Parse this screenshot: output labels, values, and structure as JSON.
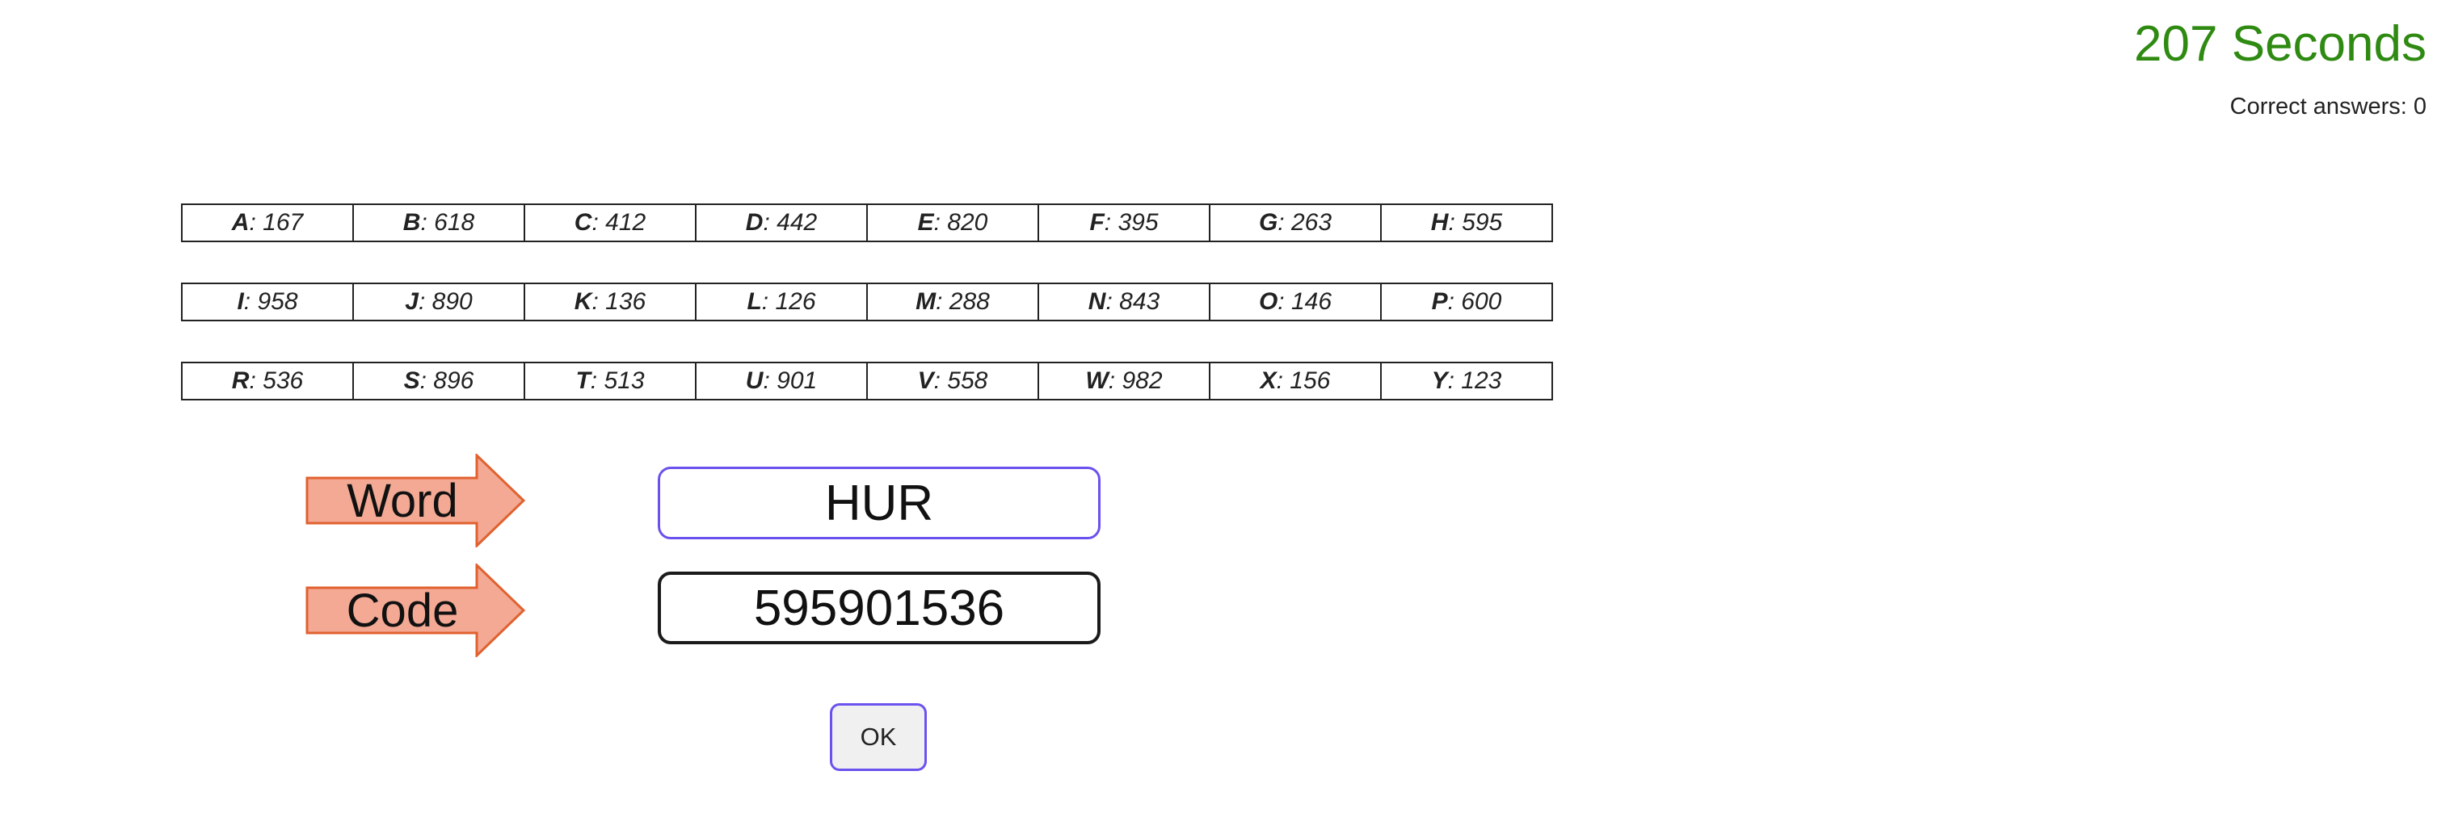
{
  "timer": "207 Seconds",
  "correct_answers": "Correct answers: 0",
  "code_table": [
    [
      {
        "letter": "A",
        "value": ": 167"
      },
      {
        "letter": "B",
        "value": ": 618"
      },
      {
        "letter": "C",
        "value": ": 412"
      },
      {
        "letter": "D",
        "value": ": 442"
      },
      {
        "letter": "E",
        "value": ": 820"
      },
      {
        "letter": "F",
        "value": ": 395"
      },
      {
        "letter": "G",
        "value": ": 263"
      },
      {
        "letter": "H",
        "value": ": 595"
      }
    ],
    [
      {
        "letter": "I",
        "value": ": 958"
      },
      {
        "letter": "J",
        "value": ": 890"
      },
      {
        "letter": "K",
        "value": ": 136"
      },
      {
        "letter": "L",
        "value": ": 126"
      },
      {
        "letter": "M",
        "value": ": 288"
      },
      {
        "letter": "N",
        "value": ": 843"
      },
      {
        "letter": "O",
        "value": ": 146"
      },
      {
        "letter": "P",
        "value": ": 600"
      }
    ],
    [
      {
        "letter": "R",
        "value": ": 536"
      },
      {
        "letter": "S",
        "value": ": 896"
      },
      {
        "letter": "T",
        "value": ": 513"
      },
      {
        "letter": "U",
        "value": ": 901"
      },
      {
        "letter": "V",
        "value": ": 558"
      },
      {
        "letter": "W",
        "value": ": 982"
      },
      {
        "letter": "X",
        "value": ": 156"
      },
      {
        "letter": "Y",
        "value": ": 123"
      }
    ]
  ],
  "word_label": "Word",
  "code_label": "Code",
  "word_value": "HUR",
  "code_value": "595901536",
  "ok_label": "OK",
  "colors": {
    "timer": "#2f8a12",
    "arrow_fill": "#f3a994",
    "arrow_stroke": "#e0612f",
    "focus_border": "#6a52ee"
  },
  "icons": {
    "word_arrow": "right-arrow-icon",
    "code_arrow": "right-arrow-icon"
  }
}
